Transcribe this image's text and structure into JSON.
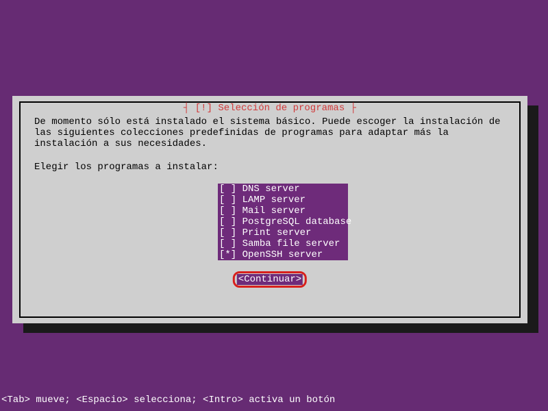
{
  "dialog": {
    "title": "┤ [!] Selección de programas ├",
    "body": "De momento sólo está instalado el sistema básico. Puede escoger la instalación de las siguientes colecciones predefinidas de programas para adaptar más la instalación a sus necesidades.",
    "prompt": "Elegir los programas a instalar:",
    "options": [
      {
        "checked": false,
        "label": "DNS server"
      },
      {
        "checked": false,
        "label": "LAMP server"
      },
      {
        "checked": false,
        "label": "Mail server"
      },
      {
        "checked": false,
        "label": "PostgreSQL database"
      },
      {
        "checked": false,
        "label": "Print server"
      },
      {
        "checked": false,
        "label": "Samba file server"
      },
      {
        "checked": true,
        "label": "OpenSSH server"
      }
    ],
    "continue_label": "<Continuar>"
  },
  "footer_hint": "<Tab> mueve; <Espacio> selecciona; <Intro> activa un botón"
}
